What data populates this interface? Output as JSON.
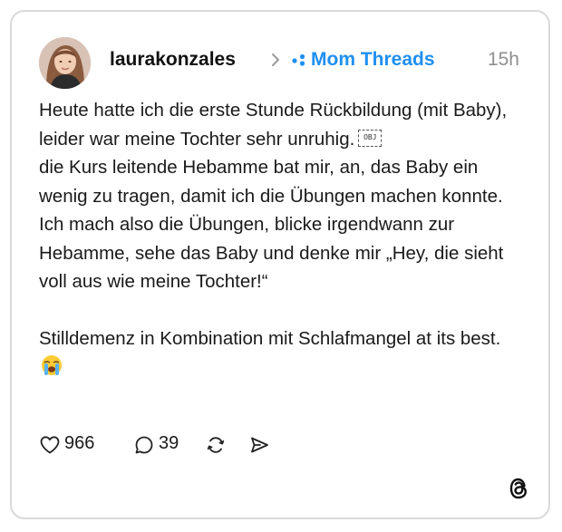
{
  "post": {
    "author": {
      "username": "laurakonzales",
      "avatar_icon": "avatar-photo"
    },
    "community": {
      "name": "Mom Threads",
      "icon": "community-dots-icon",
      "color": "#1f8ff0"
    },
    "timestamp": "15h",
    "body": {
      "para1_part1": "Heute hatte ich die erste Stunde Rückbildung (mit Baby), leider war meine Tochter sehr unruhig.",
      "obj_placeholder": "OBJ",
      "para1_part2": "die Kurs leitende Hebamme bat mir, an, das Baby ein wenig zu tragen, damit ich die Übungen machen konnte. Ich mach also die Übungen, blicke irgendwann zur Hebamme, sehe das Baby und denke mir „Hey, die sieht voll aus wie meine Tochter!“",
      "para2": "Stilldemenz in Kombination mit Schlafmangel at its best.",
      "para2_emoji": "loudly-crying-face-emoji"
    },
    "actions": {
      "likes": "966",
      "replies": "39",
      "repost_icon": "repost-icon",
      "share_icon": "share-icon"
    },
    "brand": {
      "logo": "threads-logo-icon"
    }
  }
}
